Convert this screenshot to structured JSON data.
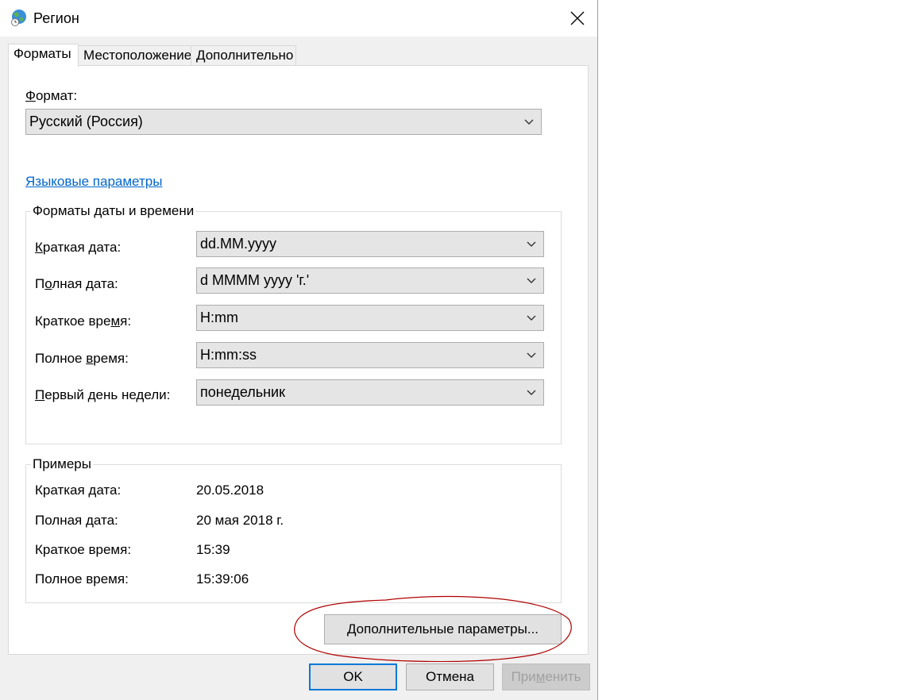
{
  "window": {
    "title": "Регион",
    "close_glyph": "✕"
  },
  "tabs": [
    {
      "label": "Форматы",
      "active": true
    },
    {
      "label": "Местоположение",
      "active": false
    },
    {
      "label": "Дополнительно",
      "active": false
    }
  ],
  "format": {
    "label_prefix": "Ф",
    "label_rest": "ормат:",
    "selected": "Русский (Россия)"
  },
  "language_link": "Языковые параметры",
  "datetime_group": {
    "title": "Форматы даты и времени",
    "rows": [
      {
        "label_pre": "",
        "label_u": "К",
        "label_post": "раткая дата:",
        "value": "dd.MM.yyyy"
      },
      {
        "label_pre": "П",
        "label_u": "о",
        "label_post": "лная дата:",
        "value": "d MMMM yyyy 'г.'"
      },
      {
        "label_pre": "Краткое вре",
        "label_u": "м",
        "label_post": "я:",
        "value": "H:mm"
      },
      {
        "label_pre": "Полное ",
        "label_u": "в",
        "label_post": "ремя:",
        "value": "H:mm:ss"
      },
      {
        "label_pre": "",
        "label_u": "П",
        "label_post": "ервый день недели:",
        "value": "понедельник"
      }
    ]
  },
  "examples_group": {
    "title": "Примеры",
    "rows": [
      {
        "label": "Краткая дата:",
        "value": "20.05.2018"
      },
      {
        "label": "Полная дата:",
        "value": "20 мая 2018 г."
      },
      {
        "label": "Краткое время:",
        "value": "15:39"
      },
      {
        "label": "Полное время:",
        "value": "15:39:06"
      }
    ]
  },
  "buttons": {
    "additional": "Дополнительные параметры...",
    "ok": "OK",
    "cancel": "Отмена",
    "apply_pre": "При",
    "apply_u": "м",
    "apply_post": "енить"
  },
  "colors": {
    "link": "#0066cc",
    "annotation": "#b00000",
    "accent": "#0078d7"
  }
}
